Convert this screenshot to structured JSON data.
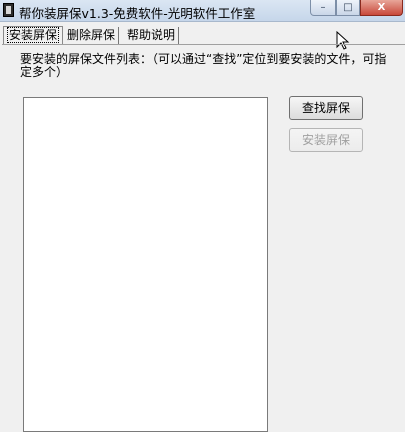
{
  "window": {
    "title": "帮你装屏保v1.3-免费软件-光明软件工作室",
    "buttons": {
      "minimize": "–",
      "maximize": "□",
      "close": "X"
    }
  },
  "tabs": [
    "安装屏保",
    "删除屏保",
    "帮助说明"
  ],
  "install_tab": {
    "instruction": "要安装的屏保文件列表：（可以通过“查找”定位到要安装的文件，可指定多个）",
    "find_button": "查找屏保",
    "install_button": "安装屏保",
    "file_list": []
  },
  "icons": [
    "app-icon",
    "mouse-cursor-icon"
  ]
}
